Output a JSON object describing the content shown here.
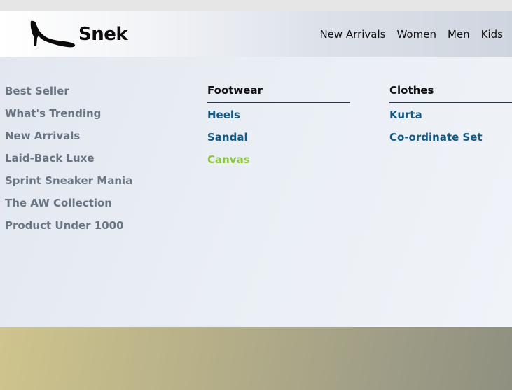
{
  "brand": {
    "name": "Snek",
    "logo_icon": "high-heel-icon"
  },
  "nav": {
    "items": [
      "New Arrivals",
      "Women",
      "Men",
      "Kids"
    ]
  },
  "menu": {
    "highlights": [
      "Best Seller",
      "What's Trending",
      "New Arrivals",
      "Laid-Back Luxe",
      "Sprint Sneaker Mania",
      "The AW Collection",
      "Product Under 1000"
    ],
    "footwear": {
      "title": "Footwear",
      "items": [
        "Heels",
        "Sandal",
        "Canvas"
      ],
      "active": "Canvas"
    },
    "clothes": {
      "title": "Clothes",
      "items": [
        "Kurta",
        "Co-ordinate Set"
      ]
    }
  },
  "colors": {
    "link": "#155a85",
    "active_link": "#8dc63f",
    "muted_link": "#6a7582"
  }
}
